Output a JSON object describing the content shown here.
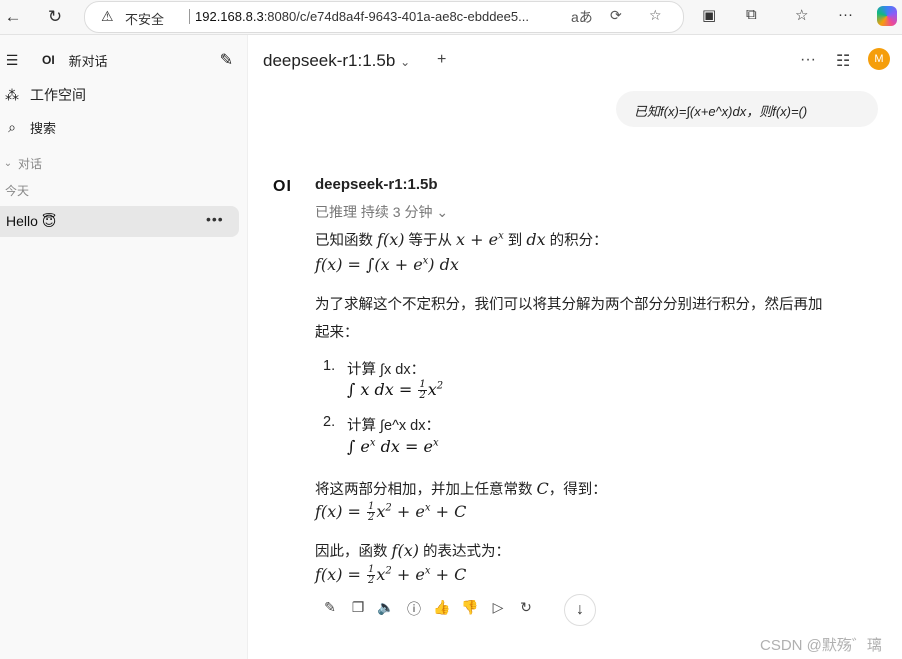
{
  "browser": {
    "insecure_label": "不安全",
    "url_host": "192.168.8.3",
    "url_rest": ":8080/c/e74d8a4f-9643-401a-ae8c-ebddee5...",
    "read_aloud": "aあ"
  },
  "sidebar": {
    "logo": "OI",
    "new_chat": "新对话",
    "workspace": "工作空间",
    "search": "搜索",
    "chats_section": "对话",
    "today_label": "今天",
    "chat_item": "Hello 😇"
  },
  "header": {
    "model": "deepseek-r1:1.5b",
    "avatar_letter": "M"
  },
  "user_message": "已知f(x)=∫(x+e^x)dx，则f(x)=()",
  "assistant": {
    "logo": "OI",
    "name": "deepseek-r1:1.5b",
    "reasoning": "已推理 持续 3 分钟",
    "p1_a": "已知函数",
    "p1_b": "等于从",
    "p1_c": "到",
    "p1_d": "的积分：",
    "p2": "为了求解这个不定积分，我们可以将其分解为两个部分分别进行积分，然后再加",
    "p2_cont": "起来：",
    "step1_num": "1.",
    "step1": "计算 ∫x dx：",
    "step2_num": "2.",
    "step2": "计算 ∫e^x dx：",
    "p3_a": "将这两部分相加，并加上任意常数",
    "p3_b": "，得到：",
    "p4_a": "因此，函数",
    "p4_b": "的表达式为："
  },
  "watermark": "CSDN @默殇゛璃"
}
